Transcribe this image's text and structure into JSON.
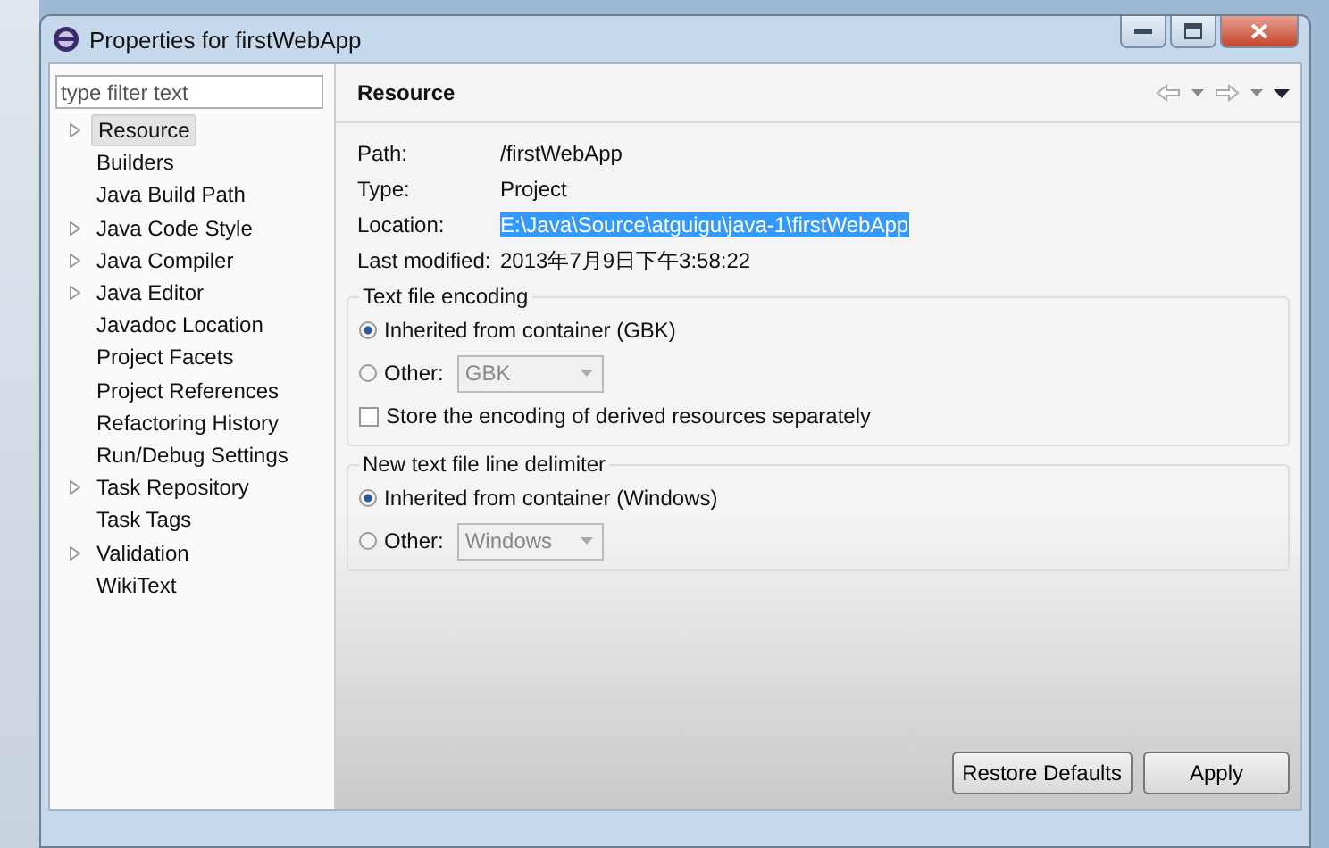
{
  "window": {
    "title": "Properties for firstWebApp"
  },
  "filter": {
    "placeholder": "type filter text"
  },
  "tree": [
    {
      "label": "Resource",
      "expandable": true,
      "selected": true
    },
    {
      "label": "Builders",
      "expandable": false,
      "selected": false
    },
    {
      "label": "Java Build Path",
      "expandable": false,
      "selected": false
    },
    {
      "label": "Java Code Style",
      "expandable": true,
      "selected": false
    },
    {
      "label": "Java Compiler",
      "expandable": true,
      "selected": false
    },
    {
      "label": "Java Editor",
      "expandable": true,
      "selected": false
    },
    {
      "label": "Javadoc Location",
      "expandable": false,
      "selected": false
    },
    {
      "label": "Project Facets",
      "expandable": false,
      "selected": false
    },
    {
      "label": "Project References",
      "expandable": false,
      "selected": false
    },
    {
      "label": "Refactoring History",
      "expandable": false,
      "selected": false
    },
    {
      "label": "Run/Debug Settings",
      "expandable": false,
      "selected": false
    },
    {
      "label": "Task Repository",
      "expandable": true,
      "selected": false
    },
    {
      "label": "Task Tags",
      "expandable": false,
      "selected": false
    },
    {
      "label": "Validation",
      "expandable": true,
      "selected": false
    },
    {
      "label": "WikiText",
      "expandable": false,
      "selected": false
    }
  ],
  "page": {
    "title": "Resource",
    "properties": [
      {
        "label": "Path:",
        "value": "/firstWebApp",
        "highlighted": false
      },
      {
        "label": "Type:",
        "value": "Project",
        "highlighted": false
      },
      {
        "label": "Location:",
        "value": "E:\\Java\\Source\\atguigu\\java-1\\firstWebApp",
        "highlighted": true
      },
      {
        "label": "Last modified:",
        "value": "2013年7月9日下午3:58:22",
        "highlighted": false
      }
    ],
    "groups": [
      {
        "title": "Text file encoding",
        "options": [
          {
            "kind": "radio",
            "label": "Inherited from container (GBK)",
            "selected": true
          },
          {
            "kind": "radio",
            "label": "Other:",
            "selected": false,
            "combo": "GBK"
          },
          {
            "kind": "checkbox",
            "label": "Store the encoding of derived resources separately",
            "checked": false
          }
        ]
      },
      {
        "title": "New text file line delimiter",
        "options": [
          {
            "kind": "radio",
            "label": "Inherited from container (Windows)",
            "selected": true
          },
          {
            "kind": "radio",
            "label": "Other:",
            "selected": false,
            "combo": "Windows"
          }
        ]
      }
    ]
  },
  "buttons": [
    {
      "label": "Restore Defaults"
    },
    {
      "label": "Apply"
    }
  ]
}
